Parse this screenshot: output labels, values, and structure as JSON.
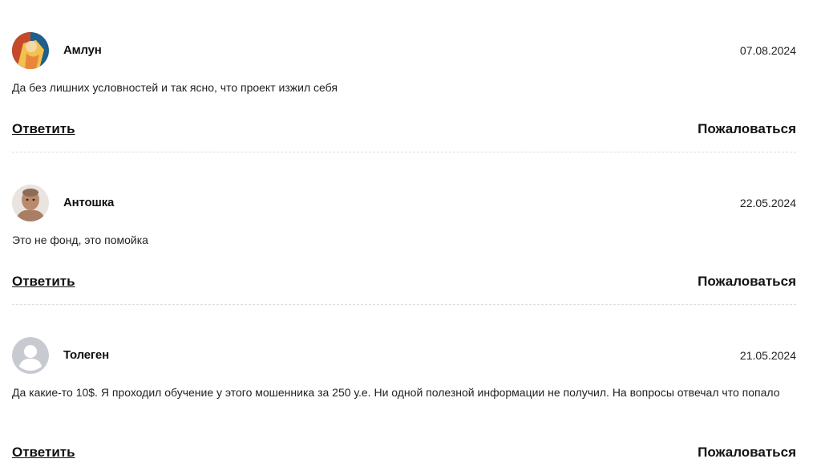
{
  "comments": [
    {
      "author": "Амлун",
      "date": "07.08.2024",
      "text": "Да без лишних условностей и так ясно, что проект изжил себя",
      "reply_label": "Ответить",
      "report_label": "Пожаловаться",
      "avatar": "photo-avatar"
    },
    {
      "author": "Антошка",
      "date": "22.05.2024",
      "text": "Это не фонд, это помойка",
      "reply_label": "Ответить",
      "report_label": "Пожаловаться",
      "avatar": "photo-avatar"
    },
    {
      "author": "Толеген",
      "date": "21.05.2024",
      "text": "Да какие-то 10$. Я проходил обучение у этого мошенника за 250 у.е. Ни одной полезной информации не получил. На вопросы отвечал что попало",
      "reply_label": "Ответить",
      "report_label": "Пожаловаться",
      "avatar": "default-user-icon"
    }
  ]
}
